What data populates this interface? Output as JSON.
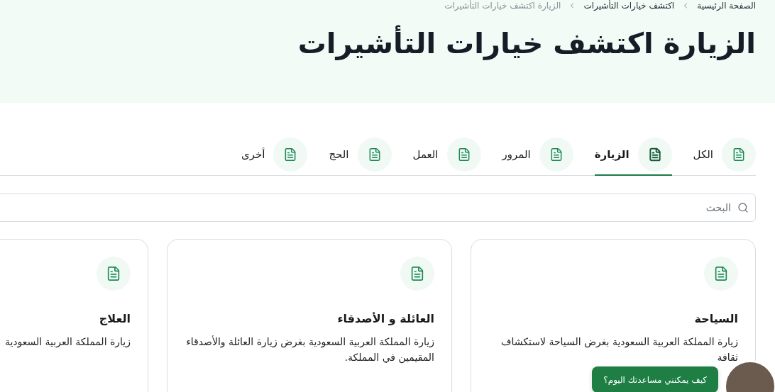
{
  "breadcrumb": [
    {
      "label": "الصفحة الرئيسية",
      "current": false
    },
    {
      "label": "اكتشف خيارات التأشيرات",
      "current": false
    },
    {
      "label": "الزيارة اكتشف خيارات التأشيرات",
      "current": true
    }
  ],
  "title": "الزيارة اكتشف خيارات التأشيرات",
  "tabs": [
    {
      "label": "الكل",
      "selected": false
    },
    {
      "label": "الزيارة",
      "selected": true
    },
    {
      "label": "المرور",
      "selected": false
    },
    {
      "label": "العمل",
      "selected": false
    },
    {
      "label": "الحج",
      "selected": false
    },
    {
      "label": "أخرى",
      "selected": false
    }
  ],
  "search": {
    "placeholder": "البحث"
  },
  "cards": [
    {
      "title": "السياحة",
      "description": "زيارة المملكة العربية السعودية بغرض السياحة لاستكشاف ثقافة"
    },
    {
      "title": "العائلة و الأصدقاء",
      "description": "زيارة المملكة العربية السعودية بغرض زيارة العائلة والأصدقاء المقيمين في المملكة."
    },
    {
      "title": "العلاج",
      "description": "زيارة المملكة العربية السعودية"
    }
  ],
  "chat": {
    "label": "كيف يمكنني مساعدتك اليوم؟"
  }
}
